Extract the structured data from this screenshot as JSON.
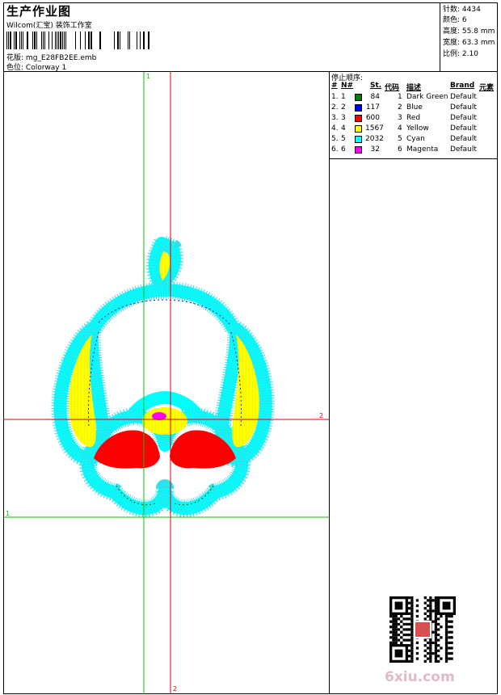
{
  "header": {
    "title": "生产作业图",
    "company": "Wilcom(汇宝) 装饰工作室",
    "file_label": "花版:",
    "file_name": "mg_E28FB2EE.emb",
    "colorway_label": "色位:",
    "colorway_name": "Colorway 1"
  },
  "stats": [
    {
      "label": "针数:",
      "value": "4434"
    },
    {
      "label": "颜色:",
      "value": "6"
    },
    {
      "label": "高度:",
      "value": "55.8 mm"
    },
    {
      "label": "宽度:",
      "value": "63.3 mm"
    },
    {
      "label": "比例:",
      "value": "2.10"
    }
  ],
  "color_table": {
    "title": "停止顺序:",
    "headers": {
      "num": "#",
      "needle": "N#",
      "stitches": "St.",
      "code": "代码",
      "desc": "描述",
      "brand": "Brand",
      "element": "元素"
    },
    "rows": [
      {
        "num": "1.",
        "needle": "1",
        "color": "#008000",
        "stitches": "84",
        "code": "1",
        "desc": "Dark Green",
        "brand": "Default"
      },
      {
        "num": "2.",
        "needle": "2",
        "color": "#0000ff",
        "stitches": "117",
        "code": "2",
        "desc": "Blue",
        "brand": "Default"
      },
      {
        "num": "3.",
        "needle": "3",
        "color": "#ff0000",
        "stitches": "600",
        "code": "3",
        "desc": "Red",
        "brand": "Default"
      },
      {
        "num": "4.",
        "needle": "4",
        "color": "#ffff00",
        "stitches": "1567",
        "code": "4",
        "desc": "Yellow",
        "brand": "Default"
      },
      {
        "num": "5.",
        "needle": "5",
        "color": "#00ffff",
        "stitches": "2032",
        "code": "5",
        "desc": "Cyan",
        "brand": "Default"
      },
      {
        "num": "6.",
        "needle": "6",
        "color": "#ff00ff",
        "stitches": "32",
        "code": "6",
        "desc": "Magenta",
        "brand": "Default"
      }
    ]
  },
  "guides": {
    "green_label": "1",
    "red_label": "2",
    "green_color": "#00c800",
    "red_color": "#e00000"
  },
  "watermark": "6xiu.com"
}
